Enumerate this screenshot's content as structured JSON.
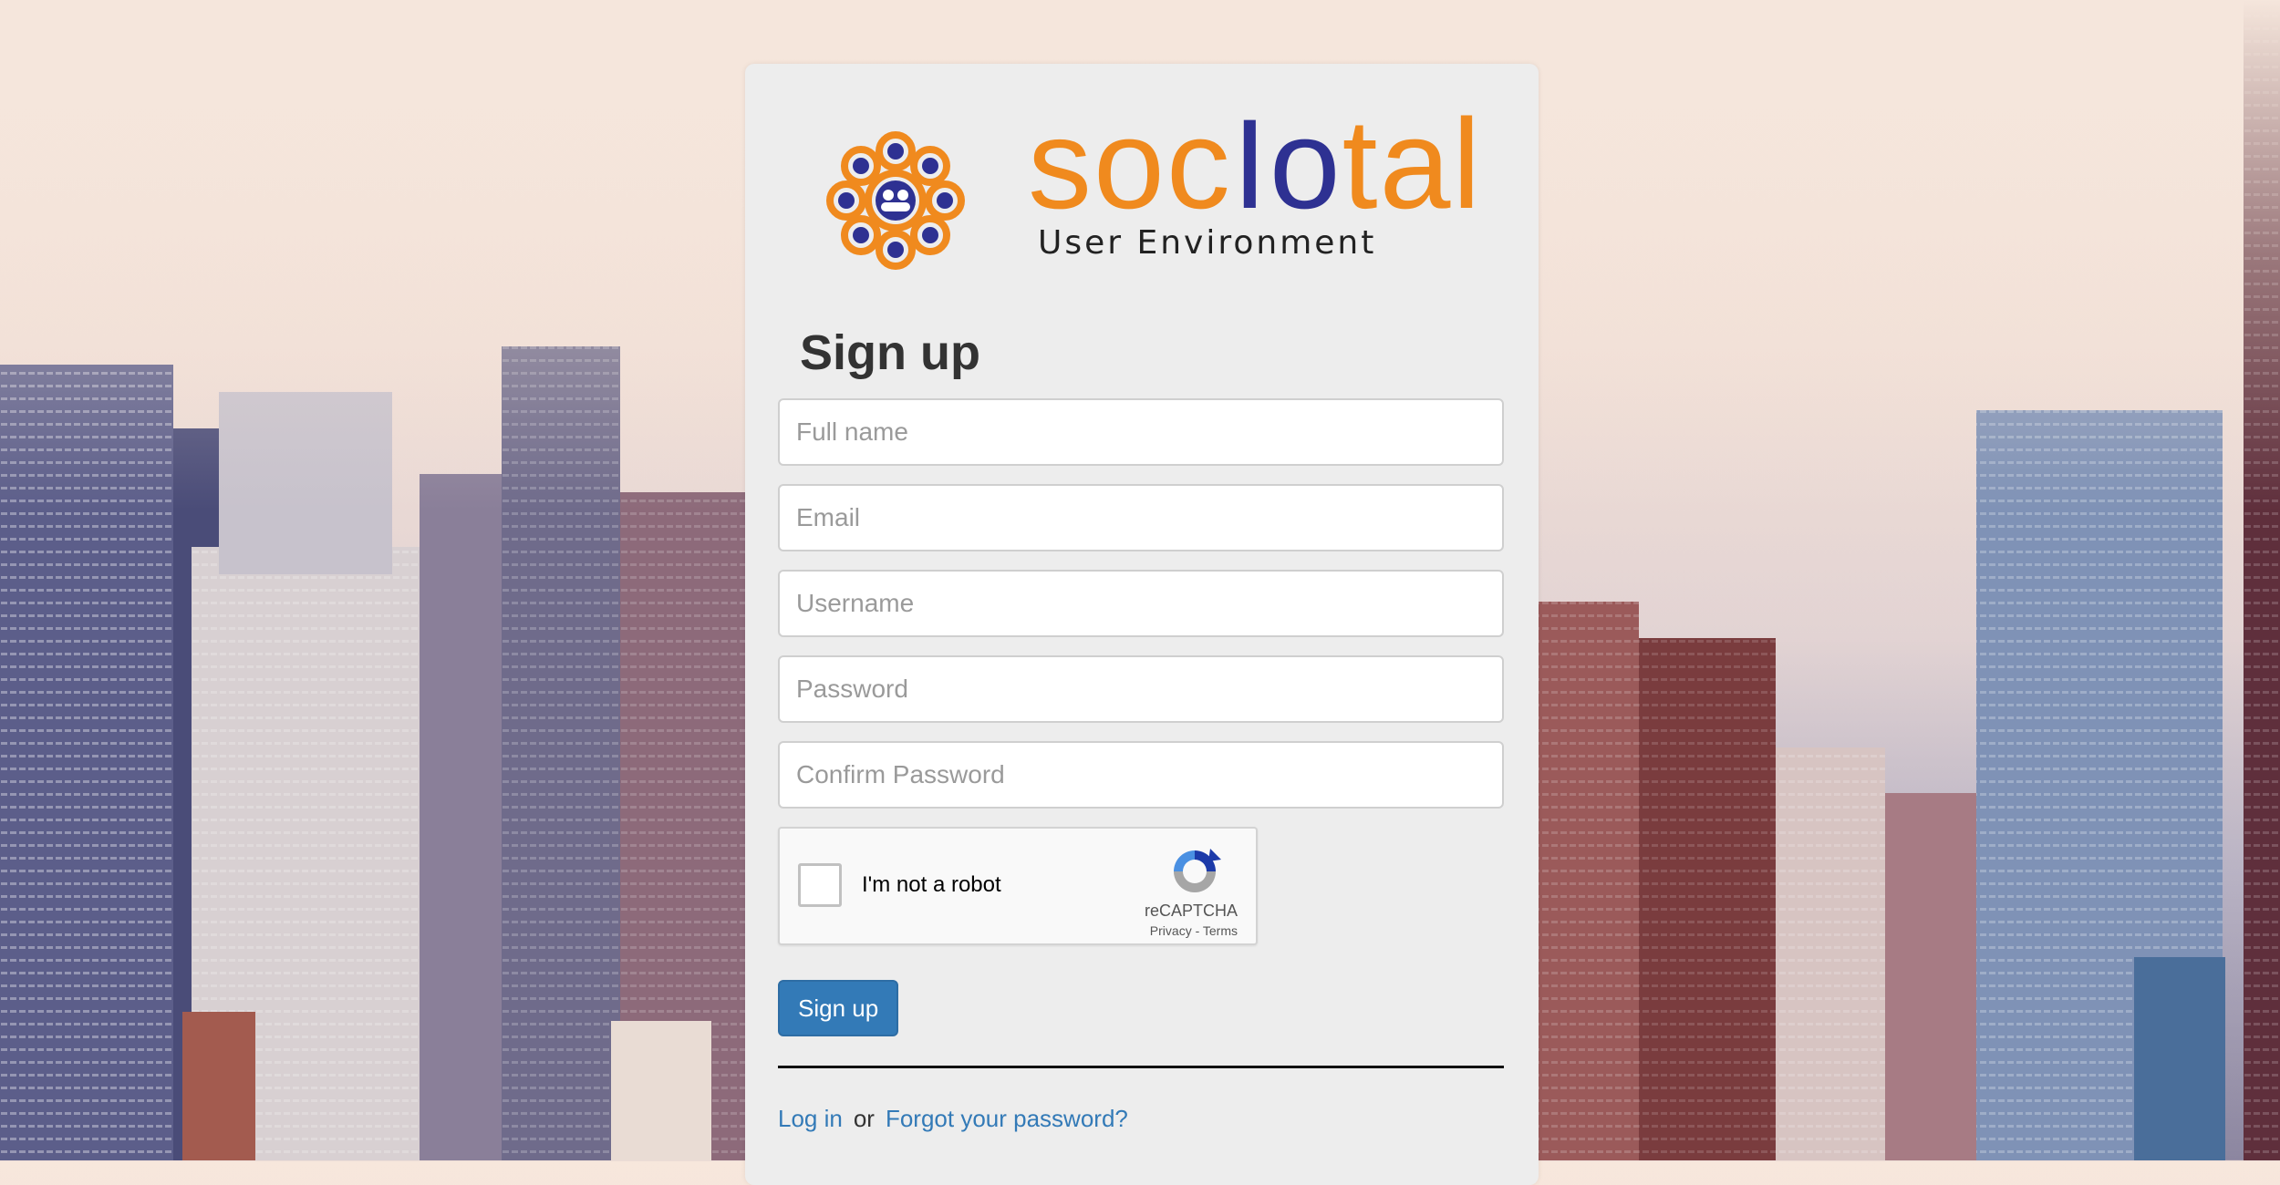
{
  "logo": {
    "brand_prefix": "soc",
    "brand_mid": "Io",
    "brand_suffix": "tal",
    "subtitle": "User Environment",
    "colors": {
      "orange": "#f08a1e",
      "navy": "#2e3192"
    }
  },
  "form": {
    "title": "Sign up",
    "fields": {
      "full_name_placeholder": "Full name",
      "email_placeholder": "Email",
      "username_placeholder": "Username",
      "password_placeholder": "Password",
      "confirm_password_placeholder": "Confirm Password"
    },
    "recaptcha": {
      "label": "I'm not a robot",
      "brand": "reCAPTCHA",
      "links": "Privacy - Terms"
    },
    "submit_label": "Sign up"
  },
  "footer": {
    "login_label": "Log in",
    "or_text": "or",
    "forgot_label": "Forgot your password?"
  },
  "colors": {
    "primary": "#337ab7"
  }
}
